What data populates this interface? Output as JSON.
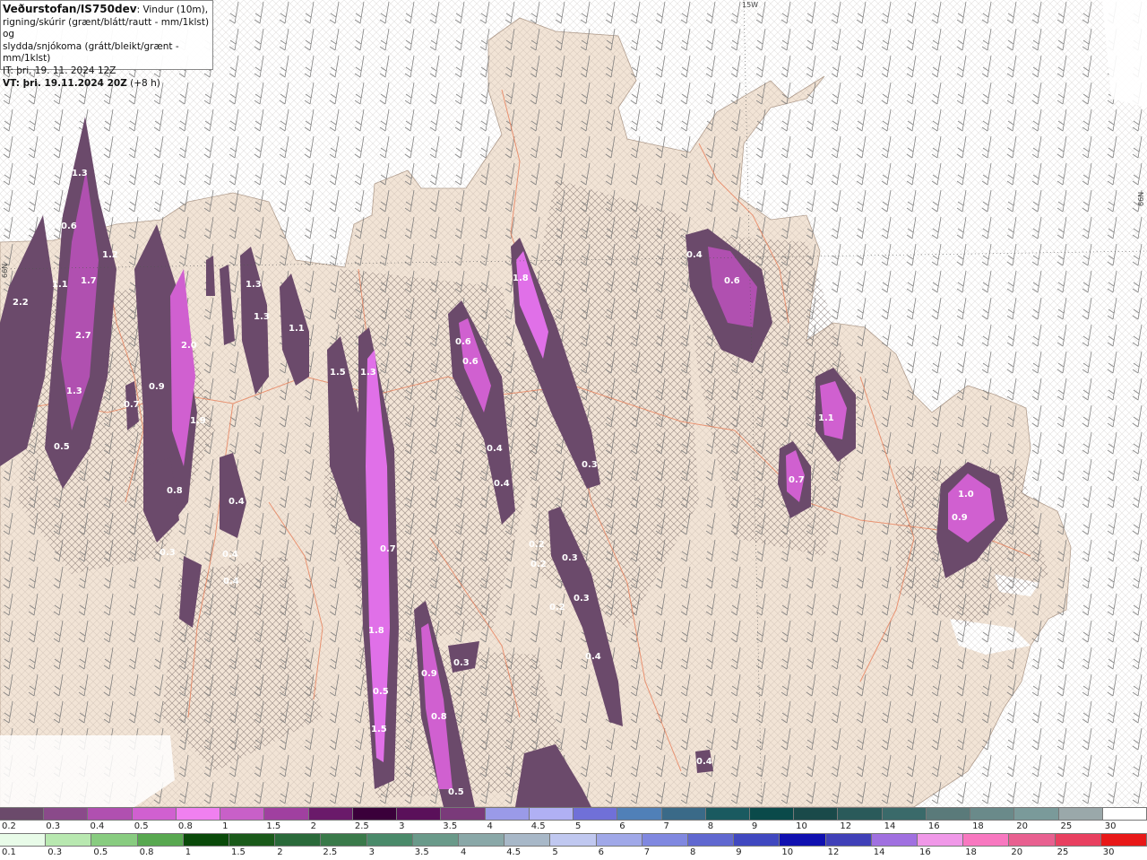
{
  "title": {
    "brand": "Veðurstofan/IS750dev",
    "line1_rest": ": Vindur (10m),",
    "line2": "rigning/skúrir (grænt/blátt/rautt - mm/1klst) og",
    "line3": "slydda/snjókoma (grátt/bleikt/grænt - mm/1klst)",
    "it_line": "IT: þri. 19. 11. 2024 12Z",
    "vt_line": "VT: þri. 19.11.2024 20Z",
    "vt_lead": " (+8 h)"
  },
  "map_labels": {
    "lon_top": "15W",
    "lat_right": "66N",
    "lat_left": "66N"
  },
  "precip_labels": [
    "1.3",
    "0.6",
    "1.1",
    "1.7",
    "1.2",
    "2.2",
    "2.7",
    "1.3",
    "0.5",
    "0.9",
    "0.7",
    "2.0",
    "1.9",
    "0.8",
    "0.3",
    "1.3",
    "1.3",
    "1.1",
    "1.5",
    "1.3",
    "0.6",
    "0.6",
    "1.8",
    "0.4",
    "0.4",
    "0.4",
    "0.4",
    "0.4",
    "0.7",
    "1.8",
    "0.5",
    "1.5",
    "0.9",
    "0.8",
    "0.5",
    "0.3",
    "0.3",
    "0.4",
    "0.3",
    "0.2",
    "0.2",
    "0.2",
    "0.3",
    "0.4",
    "0.6",
    "1.1",
    "0.7",
    "1.0",
    "0.9",
    "0.4"
  ],
  "legend_snow": {
    "labels": [
      "0.2",
      "0.3",
      "0.4",
      "0.5",
      "0.8",
      "1",
      "1.5",
      "2",
      "2.5",
      "3",
      "3.5",
      "4",
      "4.5",
      "5",
      "6",
      "7",
      "8",
      "9",
      "10",
      "12",
      "14",
      "16",
      "18",
      "20",
      "25",
      "30"
    ],
    "colors": [
      "#6b4a6b",
      "#8a4a8a",
      "#b050b0",
      "#d060d0",
      "#f080f0",
      "#c860c8",
      "#a040a0",
      "#6a1a6a",
      "#3a003a",
      "#5a105a",
      "#7a3a7a",
      "#9a9ae8",
      "#b0b0f4",
      "#7070d8",
      "#5080b8",
      "#3a6a88",
      "#1a5a60",
      "#0a4a4a",
      "#1a4a4a",
      "#2a5a5a",
      "#3a6a6a",
      "#5a7a7a",
      "#6a8a8a",
      "#7a9a9a",
      "#9aa8aa",
      "#ffffff"
    ]
  },
  "legend_rain": {
    "labels": [
      "0.1",
      "0.3",
      "0.5",
      "0.8",
      "1",
      "1.5",
      "2",
      "2.5",
      "3",
      "3.5",
      "4",
      "4.5",
      "5",
      "6",
      "7",
      "8",
      "9",
      "10",
      "12",
      "14",
      "16",
      "18",
      "20",
      "25",
      "30"
    ],
    "colors": [
      "#e8fbe8",
      "#b8e8b0",
      "#88cc80",
      "#58a850",
      "#0a4a0a",
      "#1a5a1a",
      "#2a6a3a",
      "#3a7a4a",
      "#4a8a6a",
      "#6a9a8a",
      "#8aa8a8",
      "#a8b8c8",
      "#c0c8f0",
      "#a0a8e8",
      "#8088e0",
      "#6068d0",
      "#4048c0",
      "#1010b0",
      "#4040b8",
      "#a070e0",
      "#f098e8",
      "#f878c0",
      "#e86090",
      "#e84060",
      "#e81818"
    ]
  },
  "colors": {
    "sea": "#ffffff",
    "land": "#f2e4d6",
    "road": "#e8805a",
    "snow_light": "#6b4a6b",
    "snow_mid": "#b050b0",
    "snow_high": "#f080f0"
  }
}
